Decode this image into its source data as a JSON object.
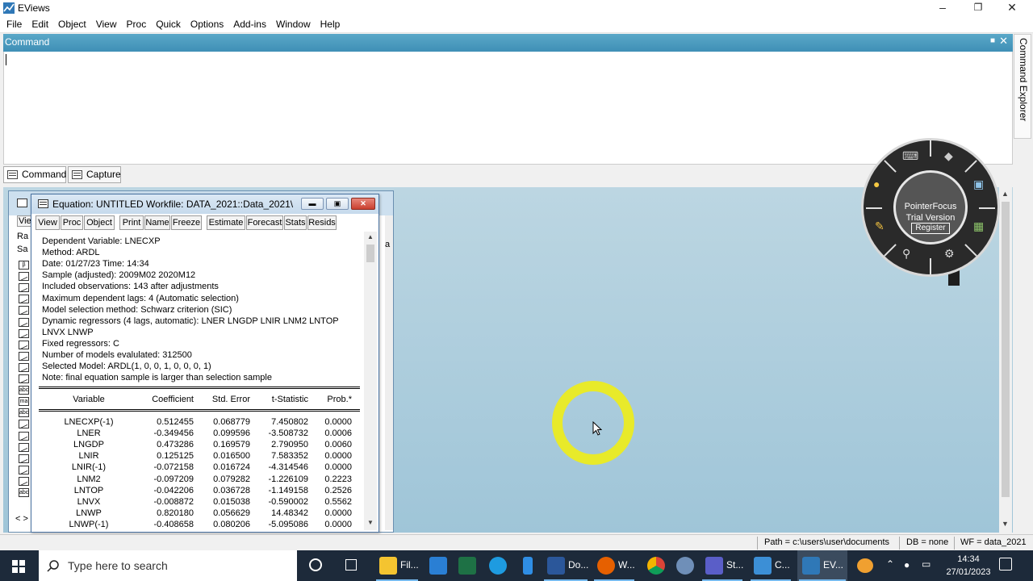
{
  "app": {
    "title": "EViews"
  },
  "menu": [
    "File",
    "Edit",
    "Object",
    "View",
    "Proc",
    "Quick",
    "Options",
    "Add-ins",
    "Window",
    "Help"
  ],
  "command": {
    "header": "Command",
    "tabs": [
      "Command",
      "Capture"
    ],
    "explorer_label": "Command Explorer"
  },
  "workfile": {
    "toolbar_partial": "Vie",
    "side_labels": [
      "Ra",
      "Sa"
    ],
    "right_fragment": "a",
    "nav": "< >",
    "objects": [
      "coef",
      "series",
      "series",
      "series",
      "series",
      "series",
      "series",
      "series",
      "series",
      "series",
      "series",
      "alpha",
      "map",
      "alpha",
      "series",
      "series",
      "series",
      "series",
      "series",
      "series",
      "alpha"
    ]
  },
  "equation": {
    "title": "Equation: UNTITLED   Workfile: DATA_2021::Data_2021\\",
    "toolbar": [
      "View",
      "Proc",
      "Object",
      "Print",
      "Name",
      "Freeze",
      "Estimate",
      "Forecast",
      "Stats",
      "Resids"
    ],
    "header_lines": [
      "Dependent Variable: LNECXP",
      "Method: ARDL",
      "Date: 01/27/23   Time: 14:34",
      "Sample (adjusted): 2009M02 2020M12",
      "Included observations: 143 after adjustments",
      "Maximum dependent lags: 4 (Automatic selection)",
      "Model selection method: Schwarz criterion (SIC)",
      "Dynamic regressors (4 lags, automatic): LNER LNGDP LNIR LNM2 LNTOP",
      "     LNVX LNWP",
      "Fixed regressors: C",
      "Number of models evalulated: 312500",
      "Selected Model: ARDL(1, 0, 0, 1, 0, 0, 0, 1)",
      "Note: final equation sample is larger than selection sample"
    ],
    "columns": [
      "Variable",
      "Coefficient",
      "Std. Error",
      "t-Statistic",
      "Prob.*"
    ],
    "rows": [
      [
        "LNECXP(-1)",
        "0.512455",
        "0.068779",
        "7.450802",
        "0.0000"
      ],
      [
        "LNER",
        "-0.349456",
        "0.099596",
        "-3.508732",
        "0.0006"
      ],
      [
        "LNGDP",
        "0.473286",
        "0.169579",
        "2.790950",
        "0.0060"
      ],
      [
        "LNIR",
        "0.125125",
        "0.016500",
        "7.583352",
        "0.0000"
      ],
      [
        "LNIR(-1)",
        "-0.072158",
        "0.016724",
        "-4.314546",
        "0.0000"
      ],
      [
        "LNM2",
        "-0.097209",
        "0.079282",
        "-1.226109",
        "0.2223"
      ],
      [
        "LNTOP",
        "-0.042206",
        "0.036728",
        "-1.149158",
        "0.2526"
      ],
      [
        "LNVX",
        "-0.008872",
        "0.015038",
        "-0.590002",
        "0.5562"
      ],
      [
        "LNWP",
        "0.820180",
        "0.056629",
        "14.48342",
        "0.0000"
      ],
      [
        "LNWP(-1)",
        "-0.408658",
        "0.080206",
        "-5.095086",
        "0.0000"
      ]
    ]
  },
  "status": {
    "path": "Path = c:\\users\\user\\documents",
    "db": "DB = none",
    "wf": "WF = data_2021"
  },
  "pointerfocus": {
    "name": "PointerFocus",
    "trial": "Trial Version",
    "register": "Register"
  },
  "taskbar": {
    "search_placeholder": "Type here to search",
    "apps": [
      {
        "name": "cortana",
        "label": ""
      },
      {
        "name": "task-view",
        "label": ""
      },
      {
        "name": "file-explorer",
        "label": "Fil..."
      },
      {
        "name": "mail",
        "label": ""
      },
      {
        "name": "excel",
        "label": ""
      },
      {
        "name": "edge",
        "label": ""
      },
      {
        "name": "phone",
        "label": ""
      },
      {
        "name": "word",
        "label": "Do..."
      },
      {
        "name": "firefox",
        "label": "W..."
      },
      {
        "name": "chrome",
        "label": ""
      },
      {
        "name": "stata-like",
        "label": ""
      },
      {
        "name": "st-app",
        "label": "St..."
      },
      {
        "name": "c-app",
        "label": "C..."
      },
      {
        "name": "eviews",
        "label": "EV..."
      }
    ],
    "time": "14:34",
    "date": "27/01/2023"
  },
  "colors": {
    "cmd_header": "#3f8fb6",
    "workspace": "#a8cbdc",
    "taskbar": "#1d2a3a",
    "ring": "#e8ea2a"
  }
}
